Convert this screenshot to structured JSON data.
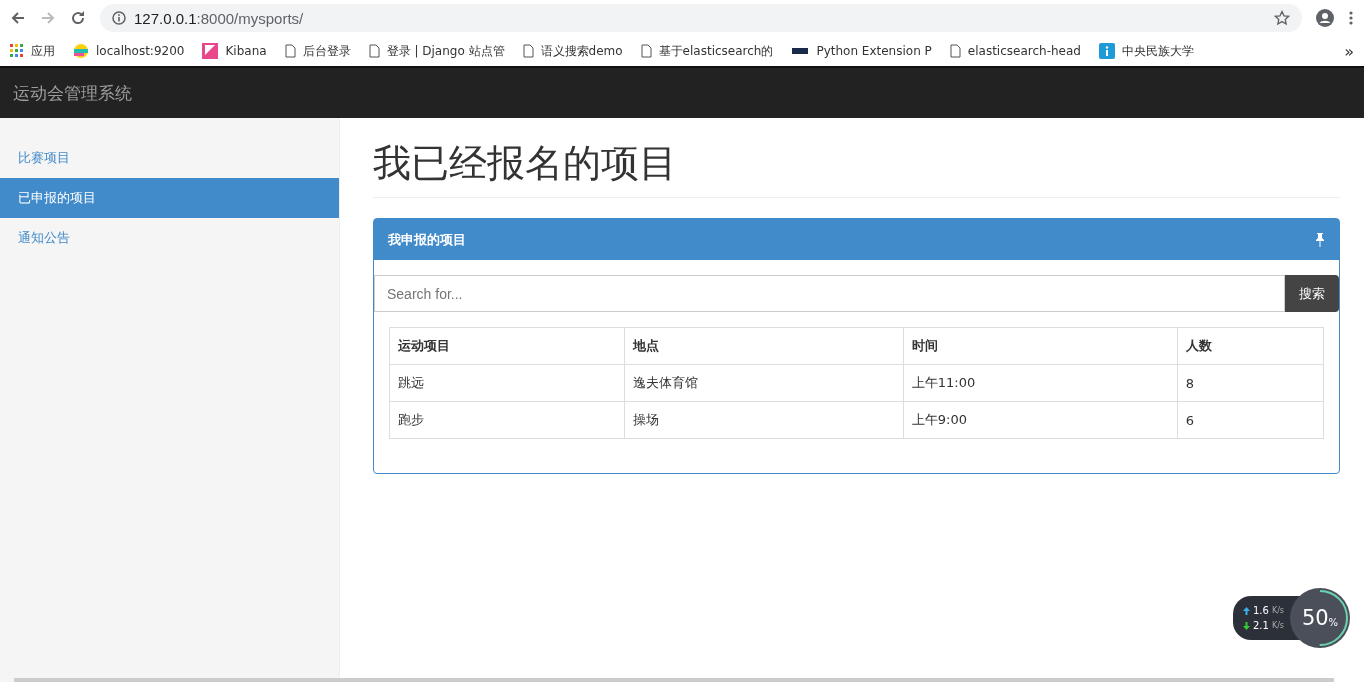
{
  "browser": {
    "url_host": "127.0.0.1",
    "url_path": ":8000/mysports/"
  },
  "bookmarks": [
    {
      "kind": "apps",
      "label": "应用"
    },
    {
      "kind": "elastic",
      "label": "localhost:9200"
    },
    {
      "kind": "kibana",
      "label": "Kibana"
    },
    {
      "kind": "page",
      "label": "后台登录"
    },
    {
      "kind": "page",
      "label": "登录 | Django 站点管"
    },
    {
      "kind": "page",
      "label": "语义搜索demo"
    },
    {
      "kind": "page",
      "label": "基于elasticsearch的"
    },
    {
      "kind": "lfd",
      "label": "Python Extension P"
    },
    {
      "kind": "page",
      "label": "elasticsearch-head"
    },
    {
      "kind": "info",
      "label": "中央民族大学"
    }
  ],
  "bookmarks_more": "»",
  "navbar": {
    "brand": "运动会管理系统"
  },
  "sidebar": {
    "items": [
      {
        "label": "比赛项目",
        "selected": false
      },
      {
        "label": "已申报的项目",
        "selected": true
      },
      {
        "label": "通知公告",
        "selected": false
      }
    ]
  },
  "page_title": "我已经报名的项目",
  "panel": {
    "title": "我申报的项目",
    "search": {
      "placeholder": "Search for...",
      "button": "搜索"
    },
    "table": {
      "columns": [
        "运动项目",
        "地点",
        "时间",
        "人数"
      ],
      "rows": [
        [
          "跳远",
          "逸夫体育馆",
          "上午11:00",
          "8"
        ],
        [
          "跑步",
          "操场",
          "上午9:00",
          "6"
        ]
      ]
    }
  },
  "speed_widget": {
    "up": "1.6",
    "up_unit": "K/s",
    "down": "2.1",
    "down_unit": "K/s",
    "percent": "50",
    "percent_sign": "%"
  }
}
